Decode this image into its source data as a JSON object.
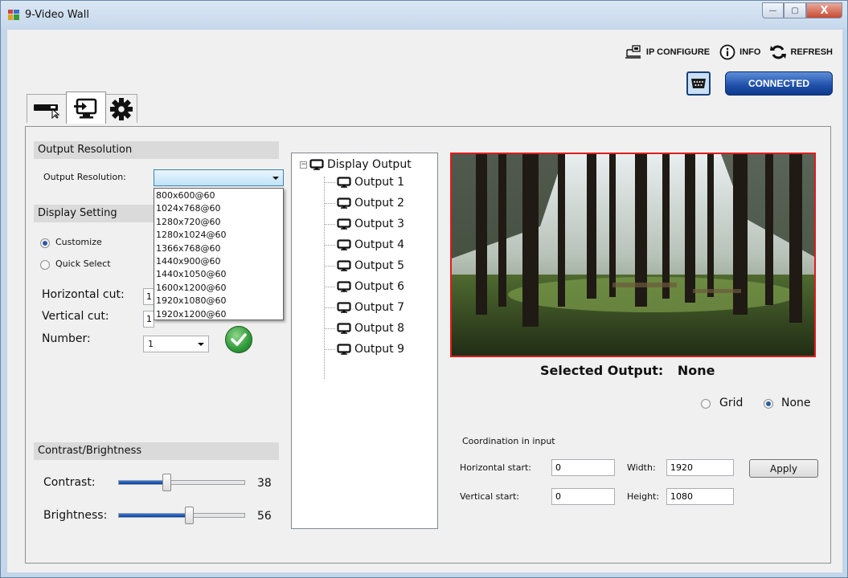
{
  "window": {
    "title": "9-Video Wall",
    "minimize": "—",
    "maximize": "▢",
    "close": "X"
  },
  "toolbar": {
    "ip_configure": "IP CONFIGURE",
    "info": "INFO",
    "refresh": "REFRESH",
    "connection_status": "CONNECTED"
  },
  "tabs": [
    {
      "icon": "device-remote-icon",
      "active": false
    },
    {
      "icon": "display-input-icon",
      "active": true
    },
    {
      "icon": "gear-icon",
      "active": false
    }
  ],
  "output_resolution": {
    "section_title": "Output Resolution",
    "label": "Output Resolution:",
    "selected": "",
    "options": [
      "800x600@60",
      "1024x768@60",
      "1280x720@60",
      "1280x1024@60",
      "1366x768@60",
      "1440x900@60",
      "1440x1050@60",
      "1600x1200@60",
      "1920x1080@60",
      "1920x1200@60"
    ]
  },
  "display_setting": {
    "section_title": "Display Setting",
    "customize": "Customize",
    "quick_select": "Quick Select",
    "selected_mode": "Customize",
    "horizontal_cut_label": "Horizontal cut:",
    "horizontal_cut_value": "1",
    "vertical_cut_label": "Vertical cut:",
    "vertical_cut_value": "1",
    "number_label": "Number:",
    "number_value": "1"
  },
  "contrast_brightness": {
    "section_title": "Contrast/Brightness",
    "contrast_label": "Contrast:",
    "contrast_value": "38",
    "contrast_fraction": 0.38,
    "brightness_label": "Brightness:",
    "brightness_value": "56",
    "brightness_fraction": 0.56
  },
  "tree": {
    "root": "Display Output",
    "items": [
      "Output 1",
      "Output 2",
      "Output 3",
      "Output 4",
      "Output 5",
      "Output 6",
      "Output 7",
      "Output 8",
      "Output 9"
    ]
  },
  "preview": {
    "selected_output_label": "Selected Output:",
    "selected_output_value": "None",
    "grid_label": "Grid",
    "none_label": "None",
    "selected_overlay": "None"
  },
  "coordination": {
    "title": "Coordination in input",
    "horizontal_start_label": "Horizontal start:",
    "horizontal_start_value": "0",
    "vertical_start_label": "Vertical start:",
    "vertical_start_value": "0",
    "width_label": "Width:",
    "width_value": "1920",
    "height_label": "Height:",
    "height_value": "1080",
    "apply_label": "Apply"
  },
  "colors": {
    "accent_blue": "#1f4fa8",
    "preview_border": "#e21b1b",
    "ok_green": "#2f9a3a"
  }
}
